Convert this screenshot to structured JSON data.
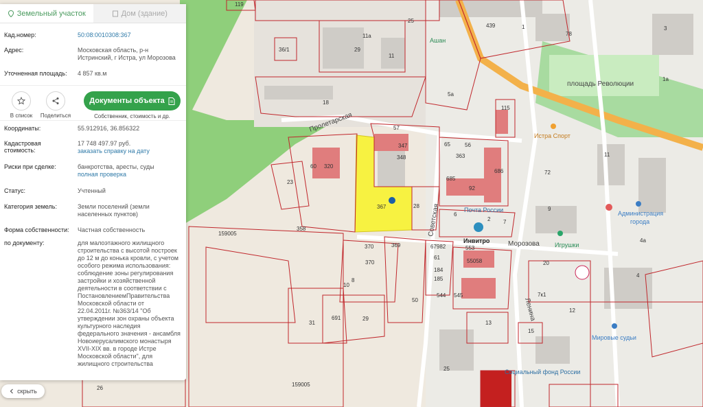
{
  "tabs": [
    {
      "label": "Земельный участок",
      "active": true
    },
    {
      "label": "Дом (здание)",
      "active": false
    }
  ],
  "fields": {
    "cadastral_number": {
      "label": "Кад.номер:",
      "value": "50:08:0010308:367"
    },
    "address": {
      "label": "Адрес:",
      "value_line1": "Московская область, р-н",
      "value_line2": "Истринский, г Истра, ул Морозова"
    },
    "area": {
      "label": "Уточненная площадь:",
      "value": "4 857 кв.м"
    },
    "coordinates": {
      "label": "Координаты:",
      "value": "55.912916, 36.856322"
    },
    "cad_value": {
      "label_line1": "Кадастровая",
      "label_line2": "стоимость:",
      "value": "17 748 497.97 руб.",
      "link": "заказать справку на дату"
    },
    "risks": {
      "label": "Риски при сделке:",
      "value": "банкротства, аресты, суды",
      "link": "полная проверка"
    },
    "status": {
      "label": "Статус:",
      "value": "Учтенный"
    },
    "category": {
      "label": "Категория земель:",
      "value_line1": "Земли поселений (земли",
      "value_line2": "населенных пунктов)"
    },
    "ownership": {
      "label": "Форма собственности:",
      "value": "Частная собственность"
    },
    "by_document": {
      "label": "по документу:",
      "lines": [
        "для малоэтажного жилищного",
        "строительства с высотой построек",
        "до 12 м до конька кровли, с учетом",
        "особого режима использования:",
        "соблюдение зоны регулирования",
        "застройки и хозяйственной",
        "деятельности в соответствии с",
        "ПостановлениемПравительства",
        "Московской области от",
        "22.04.2011г. №363/14 \"Об",
        "утверждении зон охраны объекта",
        "культурного наследия",
        "федерального значения - ансамбля",
        "Новоиерусалимского монастыря",
        "XVII-XIX вв. в городе Истре",
        "Московской области\", для",
        "жилищного строительства"
      ]
    }
  },
  "actions": {
    "to_list": "В список",
    "share": "Поделиться",
    "docs_button": "Документы объекта",
    "docs_sub": "Собственник, стоимость и др."
  },
  "hide_button": "скрыть",
  "map": {
    "streets": {
      "proletarskaya": "Пролетарская",
      "morozova": "Морозова",
      "revolution_square": "площадь Революции",
      "sovetskaya": "Советская",
      "lenina": "Ленина"
    },
    "pois": {
      "ashan": "Ашан",
      "istra_sport": "Истра Спорт",
      "pochta": "Почта России",
      "invitro": "Инвитро",
      "igrushki": "Игрушки",
      "administration_line1": "Администрация",
      "administration_line2": "города",
      "mirovye_sudy": "Мировые судьи",
      "social_fund": "Социальный фонд России"
    },
    "parcels": {
      "n119": "119",
      "n25": "25",
      "n36_1": "36/1",
      "n29": "29",
      "n11a": "11а",
      "n11": "11",
      "n18": "18",
      "n439": "439",
      "n78": "78",
      "n1_top": "1",
      "n5a": "5а",
      "n115": "115",
      "n57": "57",
      "n347": "347",
      "n348": "348",
      "n60": "60",
      "n320": "320",
      "n23": "23",
      "n367": "367",
      "n28": "28",
      "n65": "65",
      "n56": "56",
      "n363": "363",
      "n685": "685",
      "n92": "92",
      "n686": "686",
      "n72": "72",
      "n9": "9",
      "n6": "6",
      "n7": "7",
      "n159005_a": "159005",
      "n358": "358",
      "n370_a": "370",
      "n370_b": "370",
      "n369": "369",
      "n67982": "67982",
      "n61": "61",
      "n184": "184",
      "n185": "185",
      "n553": "553",
      "n55058": "55058",
      "n544": "544",
      "n545": "545",
      "n10": "10",
      "n8": "8",
      "n50": "50",
      "n31": "31",
      "n691": "691",
      "n29b": "29",
      "n13": "13",
      "n15": "15",
      "n25b": "25",
      "n20": "20",
      "n12": "12",
      "n7k1": "7к1",
      "n4": "4",
      "n4a": "4а",
      "n26": "26",
      "n159005_b": "159005",
      "n2": "2",
      "n1a": "1а",
      "n11b": "11",
      "n3": "3"
    }
  }
}
